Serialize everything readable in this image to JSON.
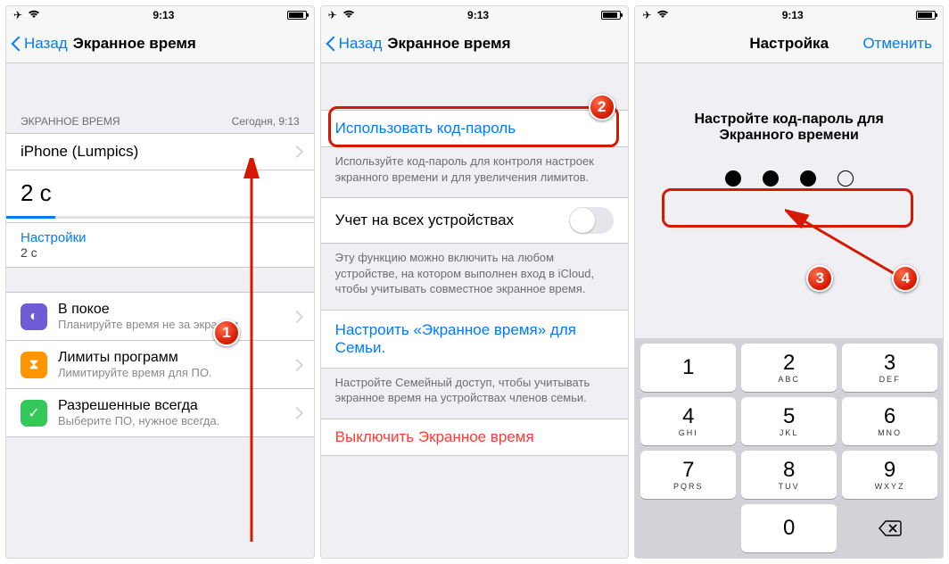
{
  "status": {
    "time": "9:13"
  },
  "nav": {
    "back": "Назад",
    "title": "Экранное время",
    "setup_title": "Настройка",
    "cancel": "Отменить"
  },
  "panel1": {
    "group_label": "ЭКРАННОЕ ВРЕМЯ",
    "group_time": "Сегодня, 9:13",
    "device": "iPhone (Lumpics)",
    "duration": "2 с",
    "settings_label": "Настройки",
    "settings_value": "2 с",
    "items": [
      {
        "label": "В покое",
        "hint": "Планируйте время не за экраном"
      },
      {
        "label": "Лимиты программ",
        "hint": "Лимитируйте время для ПО."
      },
      {
        "label": "Разрешенные всегда",
        "hint": "Выберите ПО, нужное всегда."
      }
    ]
  },
  "panel2": {
    "use_passcode": "Использовать код-пароль",
    "use_passcode_note": "Используйте код-пароль для контроля настроек экранного времени и для увеличения лимитов.",
    "share_label": "Учет на всех устройствах",
    "share_note": "Эту функцию можно включить на любом устройстве, на котором выполнен вход в iCloud, чтобы учитывать совместное экранное время.",
    "family_link": "Настроить «Экранное время» для Семьи.",
    "family_note": "Настройте Семейный доступ, чтобы учитывать экранное время на устройствах членов семьи.",
    "turn_off": "Выключить Экранное время"
  },
  "panel3": {
    "prompt": "Настройте код-пароль для Экранного времени",
    "keys": [
      {
        "n": "1",
        "l": ""
      },
      {
        "n": "2",
        "l": "ABC"
      },
      {
        "n": "3",
        "l": "DEF"
      },
      {
        "n": "4",
        "l": "GHI"
      },
      {
        "n": "5",
        "l": "JKL"
      },
      {
        "n": "6",
        "l": "MNO"
      },
      {
        "n": "7",
        "l": "PQRS"
      },
      {
        "n": "8",
        "l": "TUV"
      },
      {
        "n": "9",
        "l": "WXYZ"
      },
      {
        "n": "0",
        "l": ""
      }
    ]
  },
  "callouts": {
    "c1": "1",
    "c2": "2",
    "c3": "3",
    "c4": "4"
  }
}
